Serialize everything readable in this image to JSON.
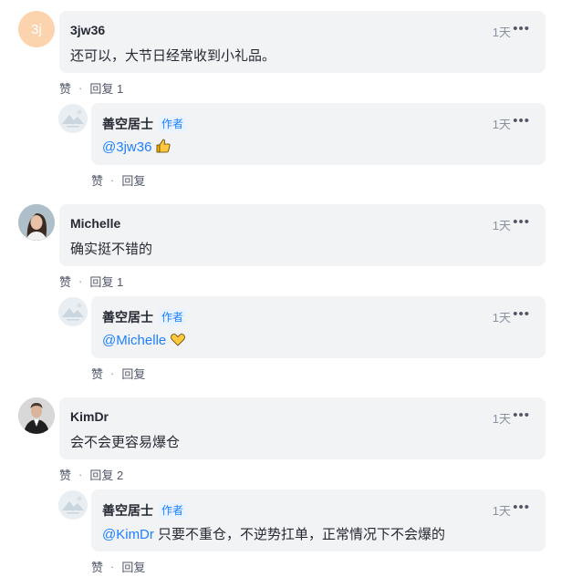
{
  "comments": [
    {
      "avatar_text": "3j",
      "name": "3jw36",
      "time": "1天",
      "content": "还可以，大节日经常收到小礼品。",
      "like_label": "赞",
      "reply_label": "回复 1",
      "reply": {
        "name": "善空居士",
        "tag": "作者",
        "time": "1天",
        "mention": "@3jw36",
        "content": "",
        "emoji": "thumbs-up-icon",
        "like_label": "赞",
        "reply_label": "回复"
      }
    },
    {
      "name": "Michelle",
      "time": "1天",
      "content": "确实挺不错的",
      "like_label": "赞",
      "reply_label": "回复 1",
      "reply": {
        "name": "善空居士",
        "tag": "作者",
        "time": "1天",
        "mention": "@Michelle",
        "content": "",
        "emoji": "heart-hands-icon",
        "like_label": "赞",
        "reply_label": "回复"
      }
    },
    {
      "name": "KimDr",
      "time": "1天",
      "content": "会不会更容易爆仓",
      "like_label": "赞",
      "reply_label": "回复 2",
      "reply": {
        "name": "善空居士",
        "tag": "作者",
        "time": "1天",
        "mention": "@KimDr",
        "content": " 只要不重仓，不逆势扛单，正常情况下不会爆的",
        "like_label": "赞",
        "reply_label": "回复"
      }
    }
  ],
  "colors": {
    "accent": "#1e80ff",
    "bubble": "#f2f3f5",
    "muted": "#8a919f"
  }
}
